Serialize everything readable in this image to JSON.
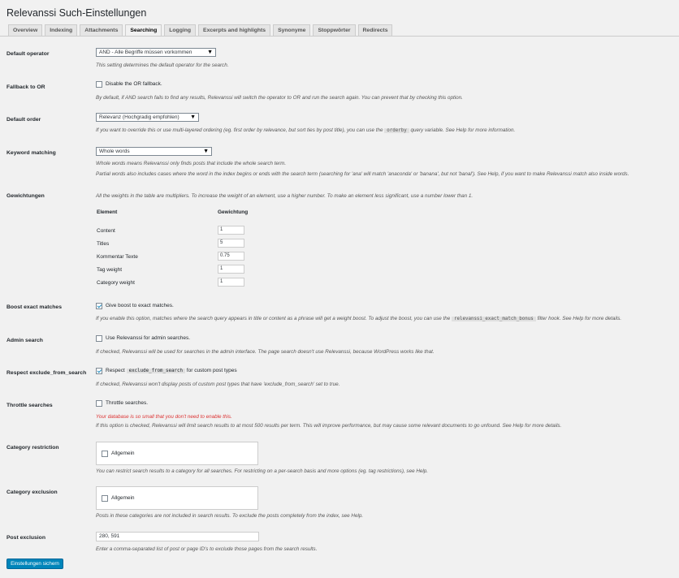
{
  "page": {
    "title": "Relevanssi Such-Einstellungen"
  },
  "tabs": [
    {
      "label": "Overview"
    },
    {
      "label": "Indexing"
    },
    {
      "label": "Attachments"
    },
    {
      "label": "Searching"
    },
    {
      "label": "Logging"
    },
    {
      "label": "Excerpts and highlights"
    },
    {
      "label": "Synonyme"
    },
    {
      "label": "Stoppwörter"
    },
    {
      "label": "Redirects"
    }
  ],
  "default_operator": {
    "label": "Default operator",
    "value": "AND - Alle Begriffe müssen vorkommen",
    "desc": "This setting determines the default operator for the search."
  },
  "fallback": {
    "label": "Fallback to OR",
    "checkbox_label": "Disable the OR fallback.",
    "checked": false,
    "desc": "By default, if AND search fails to find any results, Relevanssi will switch the operator to OR and run the search again. You can prevent that by checking this option."
  },
  "default_order": {
    "label": "Default order",
    "value": "Relevanz (Hochgradig empfohlen)",
    "desc_before": "If you want to override this or use multi-layered ordering (eg. first order by relevance, but sort ties by post title), you can use the",
    "desc_code": "orderby",
    "desc_after": "query variable. See Help for more information."
  },
  "keyword_matching": {
    "label": "Keyword matching",
    "value": "Whole words",
    "desc1": "Whole words means Relevanssi only finds posts that include the whole search term.",
    "desc2": "Partial words also includes cases where the word in the index begins or ends with the search term (searching for 'ana' will match 'anaconda' or 'banana', but not 'banal'). See Help, if you want to make Relevanssi match also inside words."
  },
  "weights": {
    "label": "Gewichtungen",
    "desc": "All the weights in the table are multipliers. To increase the weight of an element, use a higher number. To make an element less significant, use a number lower than 1.",
    "col_element": "Element",
    "col_weight": "Gewichtung",
    "rows": [
      {
        "element": "Content",
        "weight": "1"
      },
      {
        "element": "Titles",
        "weight": "5"
      },
      {
        "element": "Kommentar Texte",
        "weight": "0.75"
      },
      {
        "element": "Tag weight",
        "weight": "1"
      },
      {
        "element": "Category weight",
        "weight": "1"
      }
    ]
  },
  "boost_exact": {
    "label": "Boost exact matches",
    "checkbox_label": "Give boost to exact matches.",
    "checked": true,
    "desc_before": "If you enable this option, matches where the search query appears in title or content as a phrase will get a weight boost. To adjust the boost, you can use the",
    "desc_code": "relevanssi_exact_match_bonus",
    "desc_after": "filter hook. See Help for more details."
  },
  "admin_search": {
    "label": "Admin search",
    "checkbox_label": "Use Relevanssi for admin searches.",
    "checked": false,
    "desc": "If checked, Relevanssi will be used for searches in the admin interface. The page search doesn't use Relevanssi, because WordPress works like that."
  },
  "exclude_from_search": {
    "label": "Respect exclude_from_search",
    "checkbox_before": "Respect",
    "checkbox_code": "exclude_from_search",
    "checkbox_after": "for custom post types",
    "checked": true,
    "desc": "If checked, Relevanssi won't display posts of custom post types that have 'exclude_from_search' set to true."
  },
  "throttle": {
    "label": "Throttle searches",
    "checkbox_label": "Throttle searches.",
    "checked": false,
    "warning": "Your database is so small that you don't need to enable this.",
    "desc": "If this option is checked, Relevanssi will limit search results to at most 500 results per term. This will improve performance, but may cause some relevant documents to go unfound. See Help for more details."
  },
  "category_restriction": {
    "label": "Category restriction",
    "option": "Allgemein",
    "checked": false,
    "desc": "You can restrict search results to a category for all searches. For restricting on a per-search basis and more options (eg. tag restrictions), see Help."
  },
  "category_exclusion": {
    "label": "Category exclusion",
    "option": "Allgemein",
    "checked": false,
    "desc": "Posts in these categories are not included in search results. To exclude the posts completely from the index, see Help."
  },
  "post_exclusion": {
    "label": "Post exclusion",
    "value": "280, 591",
    "desc": "Enter a comma-separated list of post or page ID's to exclude those pages from the search results."
  },
  "save_button": {
    "label": "Einstellungen sichern"
  },
  "icons": {
    "select_arrow": "triangle-down-icon",
    "check": "checkmark-icon"
  },
  "colors": {
    "primary_button": "#0085ba",
    "warning_text": "#dc3232",
    "checkbox_tick": "#1e8cbe"
  }
}
